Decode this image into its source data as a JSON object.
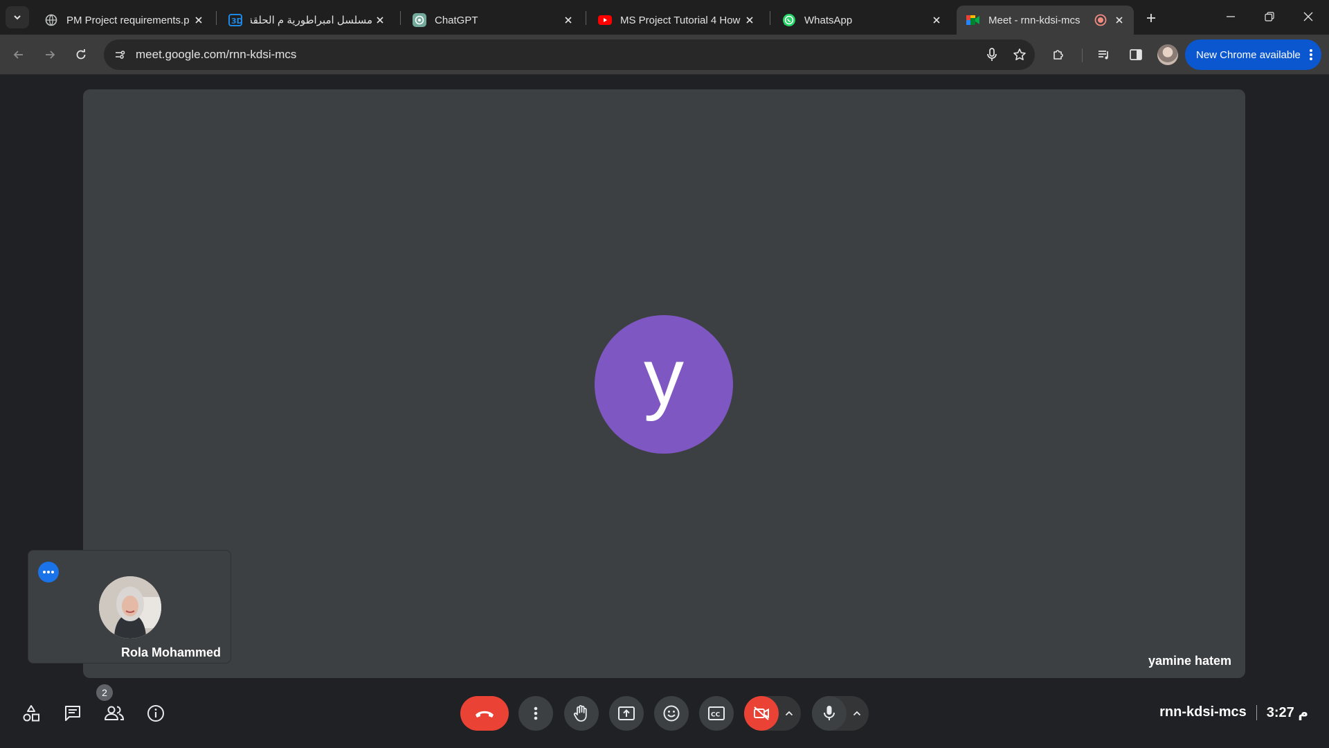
{
  "browser": {
    "tabs": [
      {
        "title": "PM Project requirements.p",
        "icon": "globe-icon"
      },
      {
        "title": "مسلسل امبراطورية م الحلقة",
        "icon": "site-3d-icon"
      },
      {
        "title": "ChatGPT",
        "icon": "chatgpt-icon"
      },
      {
        "title": "MS Project Tutorial 4 How",
        "icon": "youtube-icon"
      },
      {
        "title": "WhatsApp",
        "icon": "whatsapp-icon"
      },
      {
        "title": "Meet - rnn-kdsi-mcs",
        "icon": "meet-icon",
        "active": true,
        "recording": true
      }
    ],
    "url": "meet.google.com/rnn-kdsi-mcs",
    "update_label": "New Chrome available"
  },
  "meet": {
    "main_participant": {
      "initial": "y",
      "name": "yamine hatem",
      "avatar_color": "#7e57c2"
    },
    "self_tile": {
      "name": "Rola Mohammed"
    },
    "participants_count": "2",
    "meeting_code": "rnn-kdsi-mcs",
    "time": "3:27 م"
  },
  "colors": {
    "accent": "#1a73e8",
    "end_call": "#ea4335",
    "tile": "#3c4043",
    "background": "#202124"
  }
}
